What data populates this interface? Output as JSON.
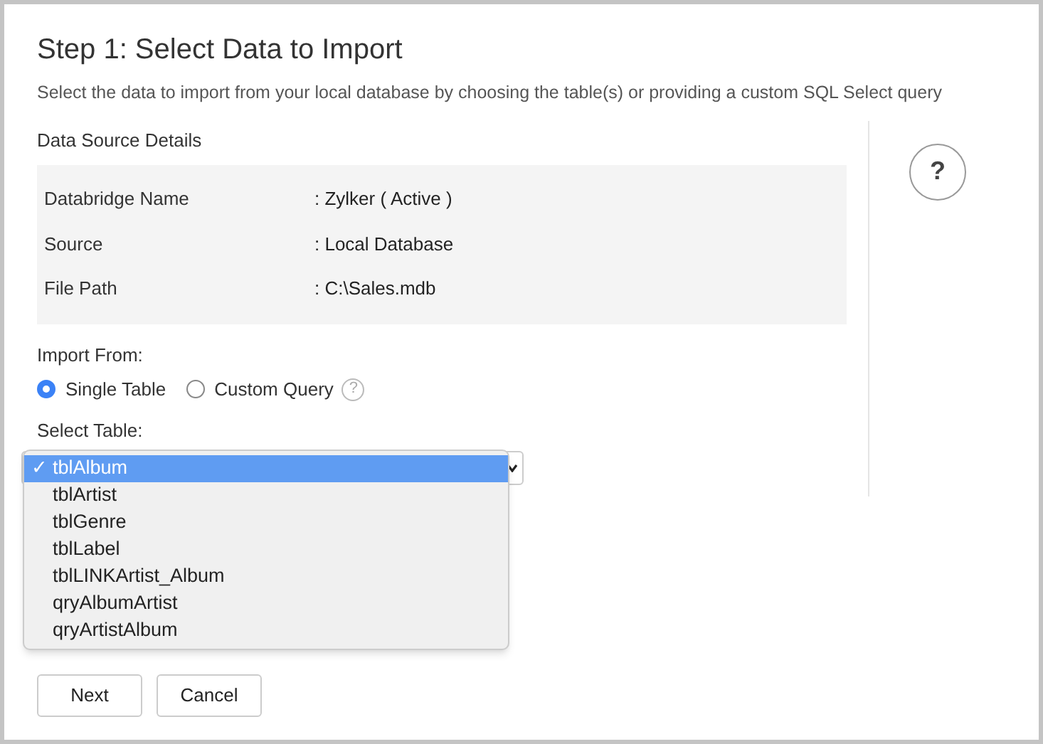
{
  "title": "Step 1: Select Data to Import",
  "subtitle": "Select the data to import from your local database by choosing the table(s) or providing a custom SQL Select query",
  "data_source": {
    "heading": "Data Source Details",
    "rows": [
      {
        "label": "Databridge Name",
        "value": ": Zylker ( Active )"
      },
      {
        "label": "Source",
        "value": ": Local Database"
      },
      {
        "label": "File Path",
        "value": ": C:\\Sales.mdb"
      }
    ]
  },
  "import_from": {
    "label": "Import From:",
    "options": [
      {
        "label": "Single Table",
        "selected": true
      },
      {
        "label": "Custom Query",
        "selected": false,
        "help": "?"
      }
    ]
  },
  "select_table": {
    "label": "Select Table:",
    "options": [
      {
        "label": "tblAlbum",
        "selected": true,
        "check": "✓"
      },
      {
        "label": "tblArtist",
        "selected": false
      },
      {
        "label": "tblGenre",
        "selected": false
      },
      {
        "label": "tblLabel",
        "selected": false
      },
      {
        "label": "tblLINKArtist_Album",
        "selected": false
      },
      {
        "label": "qryAlbumArtist",
        "selected": false
      },
      {
        "label": "qryArtistAlbum",
        "selected": false
      }
    ]
  },
  "help_button": "?",
  "buttons": [
    "Next",
    "Cancel"
  ]
}
